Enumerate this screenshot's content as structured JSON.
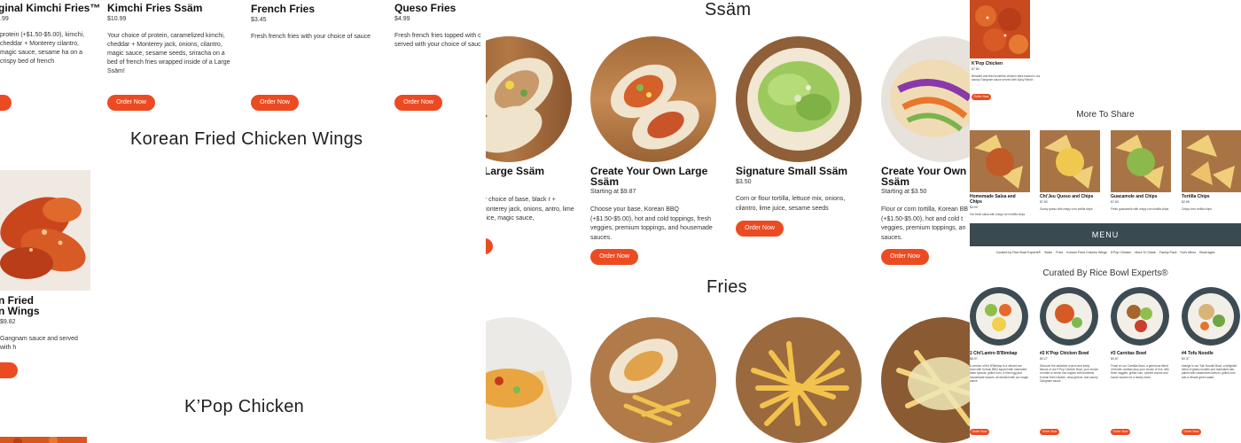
{
  "left": {
    "row1": [
      {
        "title": "ginal Kimchi Fries™",
        "price": ".99",
        "desc": "protein (+$1.50-$5.00), kimchi, cheddar + Monterey cilantro, magic sauce, sesame ha on a crispy bed of french",
        "button": "e"
      },
      {
        "title": "Kimchi Fries Ssäm",
        "price": "$10.99",
        "desc": "Your choice of protein, caramelized kimchi, cheddar + Monterey jack, onions, cilantro, magic sauce, sesame seeds, sriracha on a bed of french fries wrapped inside of a Large Ssäm!",
        "button": "Order Now"
      },
      {
        "title": "French Fries",
        "price": "$3.45",
        "desc": "Fresh french fries with your choice of sauce",
        "button": "Order Now"
      },
      {
        "title": "Queso Fries",
        "price": "$4.99",
        "desc": "Fresh french fries topped with c served with your choice of sauc",
        "button": "Order Now"
      }
    ],
    "section_wings": "Korean Fried Chicken Wings",
    "wings_item": {
      "title_line1": "n Fried",
      "title_line2": "n Wings",
      "price": "$9.82",
      "desc": "Gangnam sauce and served with h",
      "button": "ow"
    },
    "section_kpop": "K’Pop Chicken"
  },
  "mid": {
    "section_ssam": "Ssäm",
    "ssam_items": [
      {
        "title": "e Large Ssäm",
        "price": "",
        "desc": "ur choice of base, black r + Monterey jack, onions, antro, lime juice, magic sauce,",
        "button": ""
      },
      {
        "title": "Create Your Own Large Ssäm",
        "price": "Starting at $9.87",
        "desc": "Choose your base, Korean BBQ (+$1.50-$5.00), hot and cold toppings, fresh veggies, premium toppings, and housemade sauces.",
        "button": "Order Now"
      },
      {
        "title": "Signature Small Ssäm",
        "price": "$3.50",
        "desc": "Corn or flour tortilla, lettuce mix, onions, cilantro, lime juice, sesame seeds",
        "button": "Order Now"
      },
      {
        "title": "Create Your Own S Ssäm",
        "price": "Starting at $3.50",
        "desc": "Flour or corn tortilla, Korean BB (+$1.50-$5.00), hot and cold t veggies, premium toppings, an sauces.",
        "button": "Order Now"
      }
    ],
    "section_fries": "Fries"
  },
  "right": {
    "top_item": {
      "title": "K'Pop Chicken",
      "price": "$7.80",
      "desc": "Breaded and fried boneless chicken bites tossed in our savory Gangnam sauce served with Spicy Ranch",
      "button": "Order Now"
    },
    "section_share": "More To Share",
    "share_items": [
      {
        "title": "Homemade Salsa and Chips",
        "price": "$4.09",
        "desc": "Our fresh salsa with crispy corn tortilla chips"
      },
      {
        "title": "Chi'Jeu Queso and Chips",
        "price": "$7.83",
        "desc": "Gooey queso with crispy corn tortilla chips"
      },
      {
        "title": "Guacamole and Chips",
        "price": "$7.83",
        "desc": "Fresh guacamole with crispy corn tortilla chips"
      },
      {
        "title": "Tortilla Chips",
        "price": "$2.98",
        "desc": "Crispy corn tortilla chips"
      }
    ],
    "menu_label": "MENU",
    "nav": [
      "Curated by Rice Bowl Experts®",
      "Ssäm",
      "Fries",
      "Korean Fried Chicken Wings",
      "K'Pop Chicken",
      "More To Share",
      "Family Pack",
      "Kid's Menu",
      "Beverages"
    ],
    "section_curated": "Curated By Rice Bowl Experts®",
    "bowls": [
      {
        "title": "1 Chi'Lantro B'Bimbap",
        "price": "$8.97",
        "desc": "A version of the B'Bimbap is a vibrant rice bowl with Korean BBQ topped with marinated bean sprouts, grilled corn, a fried egg and housemade sauces, all drizzled with our magic sauce.",
        "button": "Order Now"
      },
      {
        "title": "#2 K'Pop Chicken Bowl",
        "price": "$9.27",
        "desc": "Discover the addictive crunch and zesty flavors of our K'Pop Chicken Bowl, your choice of white or brown rice topped with boneless Korean fried chicken, crisp greens, and savory Gangnam sauce.",
        "button": "Order Now"
      },
      {
        "title": "#3 Carnitas Bowl",
        "price": "$9.87",
        "desc": "Feast on our Carnitas Bowl, a generous blend of tender carnitas atop your choice of rice, with fresh veggies, grilled corn, pickled onions and house sauces for a hearty meal.",
        "button": "Order Now"
      },
      {
        "title": "#4 Tofu Noodle",
        "price": "$9.37",
        "desc": "Indulge in our Tofu Noodle Bowl, a delightful blend of glass noodles and marinated tofu, paired with caramelized kimchi, grilled corn and a vibrant green salad.",
        "button": "Order Now"
      }
    ]
  },
  "colors": {
    "accent": "#ec4b22",
    "menu_bar": "#394a50"
  }
}
